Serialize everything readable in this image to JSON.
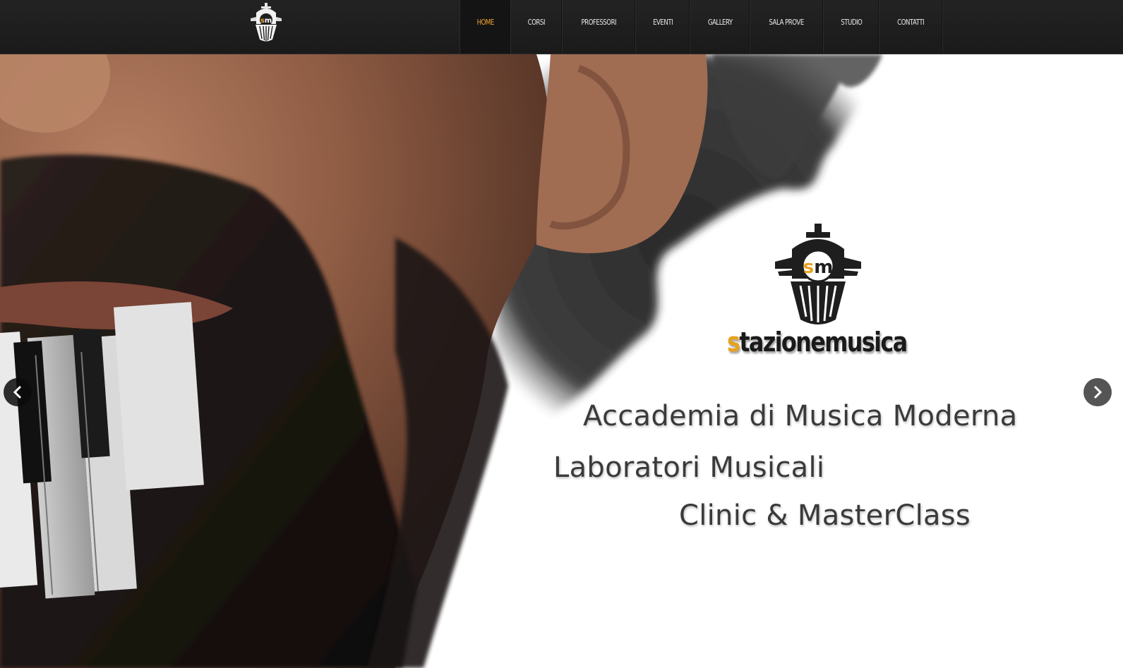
{
  "header": {
    "logo_name": "stazionemusica-logo",
    "logo_letters": "SM"
  },
  "nav": {
    "items": [
      {
        "label": "HOME",
        "active": true
      },
      {
        "label": "CORSI",
        "active": false
      },
      {
        "label": "PROFESSORI",
        "active": false
      },
      {
        "label": "EVENTI",
        "active": false
      },
      {
        "label": "GALLERY",
        "active": false
      },
      {
        "label": "SALA PROVE",
        "active": false
      },
      {
        "label": "STUDIO",
        "active": false
      },
      {
        "label": "CONTATTI",
        "active": false
      }
    ]
  },
  "slider": {
    "prev_icon": "chevron-left-icon",
    "next_icon": "chevron-right-icon",
    "wordmark_first": "s",
    "wordmark_rest": "tazionemusica",
    "taglines": [
      "Accademia di Musica Moderna",
      "Laboratori Musicali",
      "Clinic & MasterClass"
    ]
  },
  "colors": {
    "accent": "#f0a534",
    "nav_bg": "#1e1e1e",
    "nav_text": "#e8e8e8",
    "tagline_text": "#3a3a3a"
  }
}
